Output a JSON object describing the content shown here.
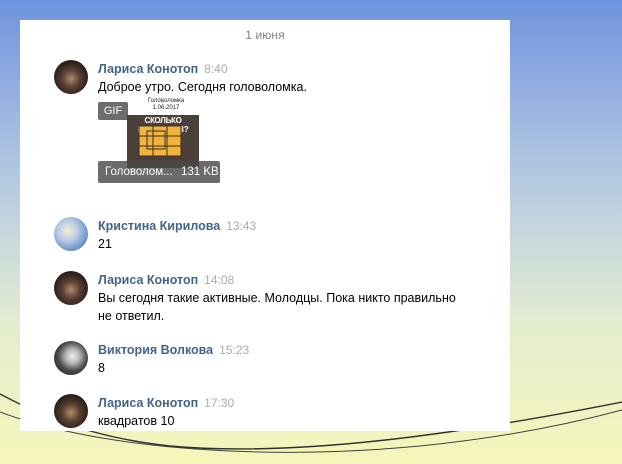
{
  "chat": {
    "date_separator": "1 июня",
    "messages": [
      {
        "author": "Лариса Конотоп",
        "time": "8:40",
        "lines": [
          "Доброе утро. Сегодня головоломка."
        ],
        "attachment": {
          "type_label": "GIF",
          "file_name": "Головолом...",
          "file_size": "131 KB",
          "thumbnail_title_line1": "Головоломка",
          "thumbnail_title_line2": "1.06.2017",
          "thumbnail_question": "СКОЛЬКО КВАДРАТОВ?"
        }
      },
      {
        "author": "Кристина Кирилова",
        "time": "13:43",
        "lines": [
          "21"
        ]
      },
      {
        "author": "Лариса Конотоп",
        "time": "14:08",
        "lines": [
          "Вы сегодня такие активные. Молодцы. Пока никто правильно",
          "не ответил."
        ]
      },
      {
        "author": "Виктория Волкова",
        "time": "15:23",
        "lines": [
          "8"
        ]
      },
      {
        "author": "Лариса Конотоп",
        "time": "17:30",
        "lines": [
          "квадратов 10"
        ]
      }
    ]
  },
  "colors": {
    "author_name": "#42648b",
    "timestamp": "#a6acb3",
    "date_separator": "#828282",
    "puzzle_orange": "#f0b43c"
  }
}
